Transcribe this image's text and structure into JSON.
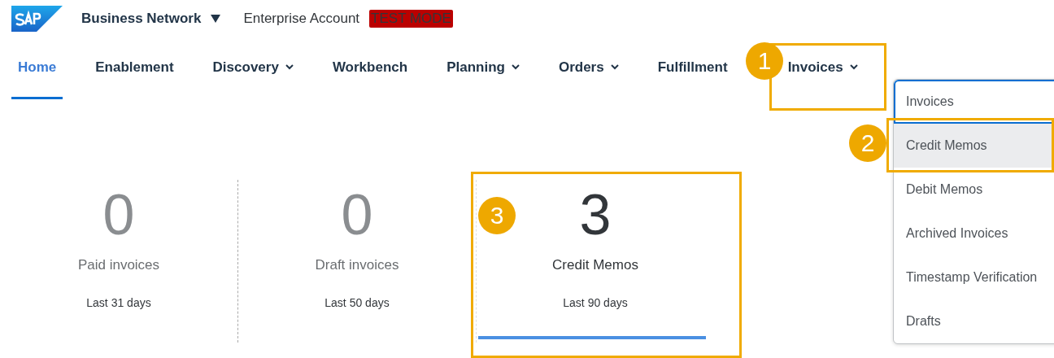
{
  "header": {
    "brand": "Business Network",
    "account": "Enterprise Account",
    "mode_badge": "TEST MODE"
  },
  "nav": [
    {
      "label": "Home",
      "has_menu": false,
      "selected": true
    },
    {
      "label": "Enablement",
      "has_menu": false,
      "selected": false
    },
    {
      "label": "Discovery",
      "has_menu": true,
      "selected": false
    },
    {
      "label": "Workbench",
      "has_menu": false,
      "selected": false
    },
    {
      "label": "Planning",
      "has_menu": true,
      "selected": false
    },
    {
      "label": "Orders",
      "has_menu": true,
      "selected": false
    },
    {
      "label": "Fulfillment",
      "has_menu": false,
      "selected": false
    },
    {
      "label": "Invoices",
      "has_menu": true,
      "selected": false,
      "callout": "1"
    }
  ],
  "menu": [
    {
      "label": "Invoices",
      "focused": true,
      "selected": false
    },
    {
      "label": "Credit Memos",
      "focused": false,
      "selected": true,
      "callout": "2"
    },
    {
      "label": "Debit Memos",
      "focused": false,
      "selected": false
    },
    {
      "label": "Archived Invoices",
      "focused": false,
      "selected": false
    },
    {
      "label": "Timestamp Verification",
      "focused": false,
      "selected": false
    },
    {
      "label": "Drafts",
      "focused": false,
      "selected": false
    }
  ],
  "tiles": [
    {
      "value": "0",
      "label": "Paid invoices",
      "period": "Last 31 days",
      "selected": false
    },
    {
      "value": "0",
      "label": "Draft invoices",
      "period": "Last 50 days",
      "selected": false
    },
    {
      "value": "3",
      "label": "Credit Memos",
      "period": "Last 90 days",
      "selected": true,
      "callout": "3"
    }
  ]
}
